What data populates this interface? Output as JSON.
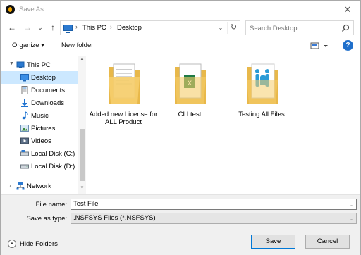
{
  "window": {
    "title": "Save As",
    "close_glyph": "✕"
  },
  "nav": {
    "back_glyph": "←",
    "forward_glyph": "→",
    "recent_glyph": "⌄",
    "up_glyph": "↑",
    "breadcrumb": [
      "This PC",
      "Desktop"
    ],
    "breadcrumb_sep": "›",
    "dropdown_glyph": "⌄",
    "refresh_glyph": "↻",
    "search_placeholder": "Search Desktop"
  },
  "toolbar": {
    "organize_label": "Organize ▾",
    "new_folder_label": "New folder",
    "help_label": "?"
  },
  "sidebar": {
    "items": [
      {
        "label": "This PC",
        "icon": "pc-icon",
        "expanded": true,
        "selected": false
      },
      {
        "label": "Desktop",
        "icon": "desktop-icon",
        "selected": true
      },
      {
        "label": "Documents",
        "icon": "documents-icon",
        "selected": false
      },
      {
        "label": "Downloads",
        "icon": "downloads-icon",
        "selected": false
      },
      {
        "label": "Music",
        "icon": "music-icon",
        "selected": false
      },
      {
        "label": "Pictures",
        "icon": "pictures-icon",
        "selected": false
      },
      {
        "label": "Videos",
        "icon": "videos-icon",
        "selected": false
      },
      {
        "label": "Local Disk (C:)",
        "icon": "disk-icon",
        "selected": false
      },
      {
        "label": "Local Disk (D:)",
        "icon": "disk-icon",
        "selected": false
      },
      {
        "label": "Network",
        "icon": "network-icon",
        "selected": false
      }
    ]
  },
  "files": [
    {
      "name": "Added new License for ALL Product",
      "icon": "folder-document-icon"
    },
    {
      "name": "CLI test",
      "icon": "folder-spreadsheet-icon"
    },
    {
      "name": "Testing All Files",
      "icon": "folder-image-icon"
    }
  ],
  "form": {
    "file_name_label": "File name:",
    "file_name_value": "Test File",
    "save_type_label": "Save as type:",
    "save_type_value": ".NSFSYS Files (*.NSFSYS)"
  },
  "footer": {
    "hide_folders_label": "Hide Folders",
    "save_label": "Save",
    "cancel_label": "Cancel"
  },
  "colors": {
    "accent": "#0078d7",
    "selection": "#cce8ff",
    "folder": "#f2c55c"
  }
}
